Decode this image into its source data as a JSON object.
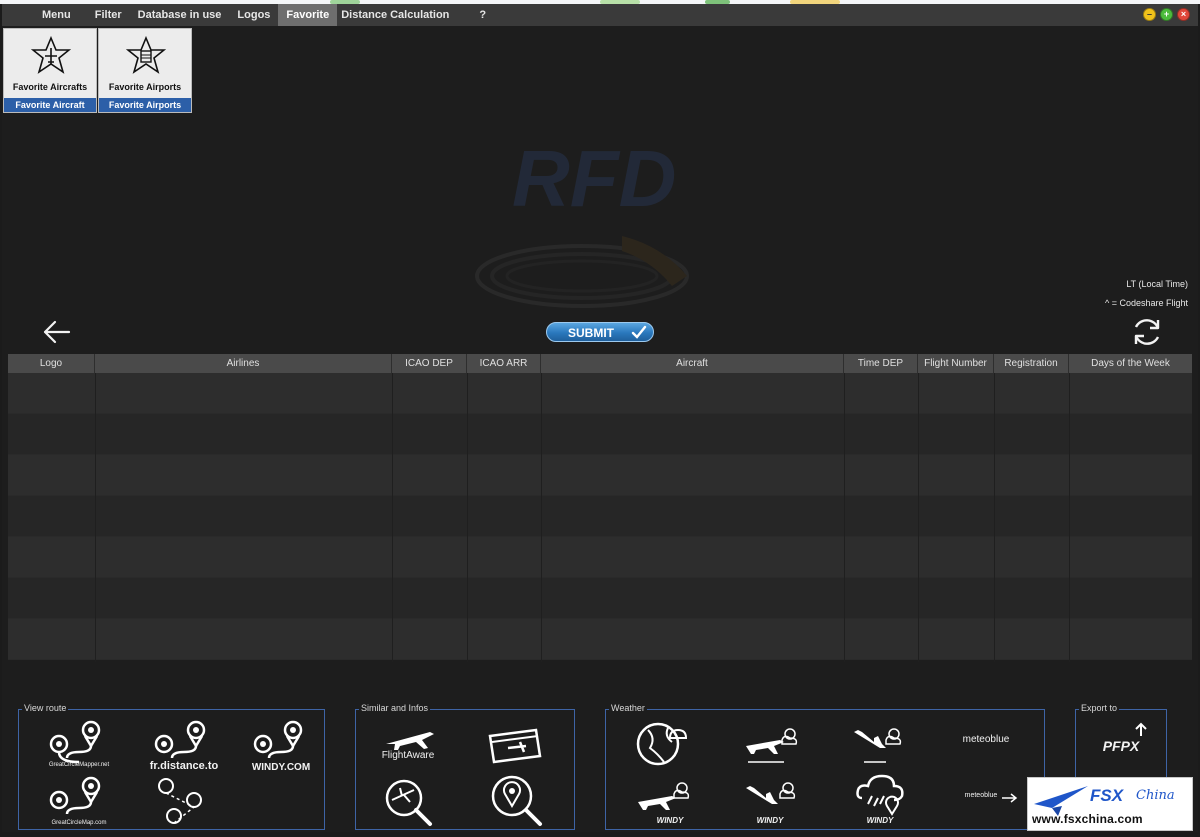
{
  "menu": {
    "items": [
      "Menu",
      "Filter",
      "Database in use",
      "Logos",
      "Favorite",
      "Distance Calculation",
      "?"
    ],
    "active_index": 4
  },
  "window_buttons": [
    "–",
    "+",
    "×"
  ],
  "favorites": [
    {
      "label": "Favorite Aircrafts",
      "button": "Favorite Aircraft"
    },
    {
      "label": "Favorite Airports",
      "button": "Favorite Airports"
    }
  ],
  "watermark_text": "RFD",
  "info": {
    "local_time": "LT (Local Time)",
    "codeshare": "^ = Codeshare Flight"
  },
  "submit_label": "SUBMIT",
  "table": {
    "columns": [
      "Logo",
      "Airlines",
      "ICAO DEP",
      "ICAO ARR",
      "Aircraft",
      "Time DEP",
      "Flight Number",
      "Registration",
      "Days of the Week"
    ],
    "row_count": 7
  },
  "panels": {
    "view_route": {
      "title": "View route",
      "tiles": [
        "GreatCircleMapper.net",
        "fr.distance.to",
        "WINDY.COM",
        "GreatCircleMap.com"
      ]
    },
    "similar": {
      "title": "Similar and Infos",
      "tiles": [
        "FlightAware"
      ]
    },
    "weather": {
      "title": "Weather",
      "tiles": [
        "WINDY",
        "WINDY",
        "WINDY",
        "meteoblue",
        "meteoblue"
      ]
    },
    "export": {
      "title": "Export to",
      "tiles": [
        "PFPX"
      ]
    }
  },
  "badge": {
    "brand_fsx": "FSX",
    "brand_china": "China",
    "url": "www.fsxchina.com"
  },
  "colors": {
    "accent_blue": "#2c5fa8",
    "panel_border": "#3e64a6",
    "submit": "#2a78bd"
  }
}
